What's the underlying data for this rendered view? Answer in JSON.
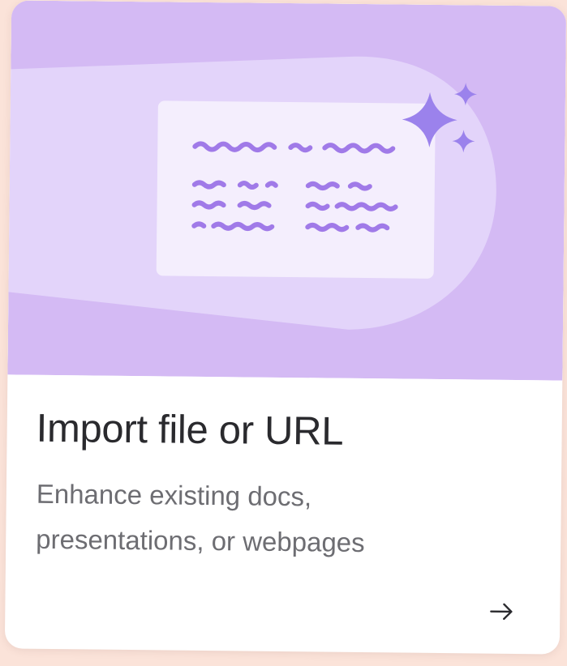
{
  "card": {
    "title": "Import file or URL",
    "description_lines": [
      "Enhance existing docs,",
      "presentations, or webpages"
    ],
    "action_icon": "arrow-right-icon"
  },
  "illustration": {
    "icons": [
      "document-icon",
      "sparkle-icon"
    ]
  },
  "colors": {
    "page_background": "#fbe3d9",
    "illustration_background": "#d4baf4",
    "swoosh": "#e3d4fa",
    "document": "#f4eefd",
    "scribble": "#a07ae8",
    "sparkle": "#9b82ec",
    "title_text": "#2a2a2e",
    "description_text": "#6d6d72"
  }
}
